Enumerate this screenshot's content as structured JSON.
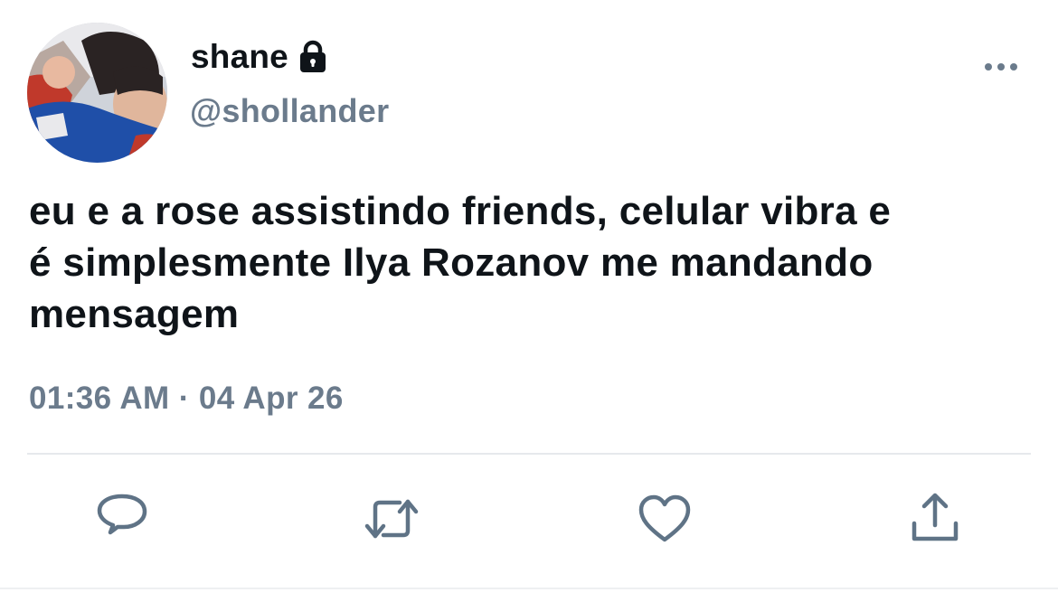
{
  "author": {
    "display_name": "shane",
    "handle": "@shollander",
    "protected_icon": "lock-icon",
    "avatar": "profile-photo"
  },
  "tweet": {
    "text": "eu e a rose assistindo friends, celular vibra e\né simplesmente Ilya Rozanov me mandando\nmensagem",
    "timestamp": "01:36 AM · 04 Apr 26"
  },
  "actions": [
    {
      "name": "reply",
      "icon": "comment-icon"
    },
    {
      "name": "retweet",
      "icon": "retweet-icon"
    },
    {
      "name": "like",
      "icon": "heart-icon"
    },
    {
      "name": "share",
      "icon": "share-icon"
    }
  ],
  "menu_icon": "more-options-icon",
  "colors": {
    "text_primary": "#0f1419",
    "text_secondary": "#6b7b8c",
    "icon": "#5f7386",
    "divider": "#e6e9ec"
  }
}
